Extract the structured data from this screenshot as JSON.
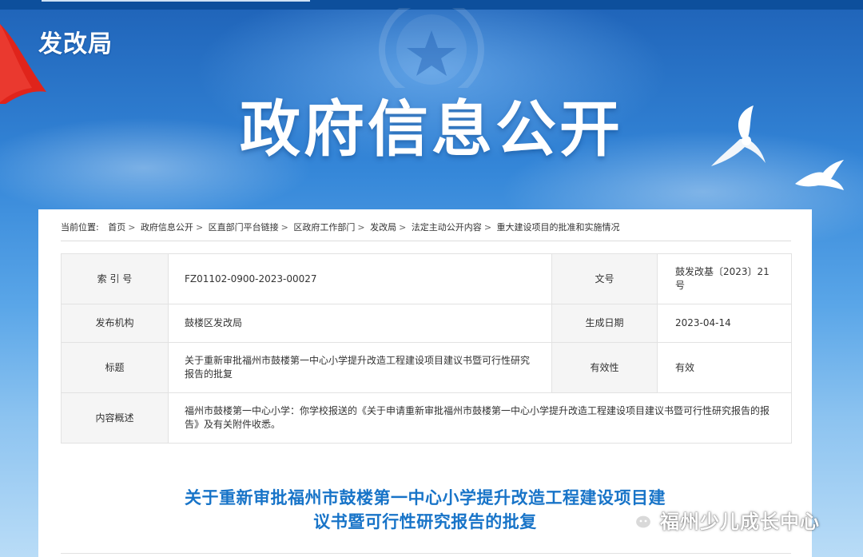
{
  "header": {
    "dept_name": "发改局",
    "main_title": "政府信息公开"
  },
  "breadcrumb": {
    "prefix": "当前位置:",
    "items": [
      "首页",
      "政府信息公开",
      "区直部门平台链接",
      "区政府工作部门",
      "发改局",
      "法定主动公开内容",
      "重大建设项目的批准和实施情况"
    ],
    "separator": ">"
  },
  "meta": {
    "index_label": "索 引 号",
    "index_value": "FZ01102-0900-2023-00027",
    "docno_label": "文号",
    "docno_value": "鼓发改基〔2023〕21号",
    "publisher_label": "发布机构",
    "publisher_value": "鼓楼区发改局",
    "date_label": "生成日期",
    "date_value": "2023-04-14",
    "title_label": "标题",
    "title_value": "关于重新审批福州市鼓楼第一中心小学提升改造工程建设项目建议书暨可行性研究报告的批复",
    "validity_label": "有效性",
    "validity_value": "有效",
    "summary_label": "内容概述",
    "summary_value": "福州市鼓楼第一中心小学：你学校报送的《关于申请重新审批福州市鼓楼第一中心小学提升改造工程建设项目建议书暨可行性研究报告的报告》及有关附件收悉。"
  },
  "document": {
    "title_line1": "关于重新审批福州市鼓楼第一中心小学提升改造工程建设项目建",
    "title_line2": "议书暨可行性研究报告的批复"
  },
  "watermark": {
    "icon": "wechat-icon",
    "text": "福州少儿成长中心"
  },
  "colors": {
    "title_blue": "#1874c8",
    "banner_dark": "#0d4f9c",
    "label_bg": "#f5f5f5",
    "flag_red": "#e0241b"
  }
}
